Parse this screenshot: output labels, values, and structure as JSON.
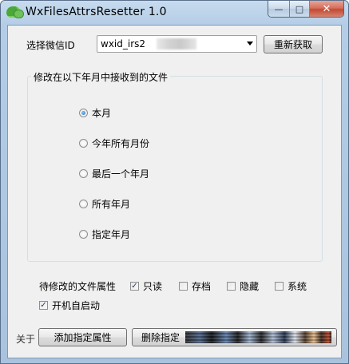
{
  "window": {
    "title": "WxFilesAttrsResetter 1.0",
    "controls": {
      "minimize": "—",
      "maximize": "□",
      "close": "✕"
    }
  },
  "wechat_id": {
    "label": "选择微信ID",
    "selected_value": "wxid_irs2",
    "refresh_button": "重新获取"
  },
  "month_group": {
    "title": "修改在以下年月中接收到的文件",
    "options": [
      {
        "label": "本月",
        "selected": true
      },
      {
        "label": "今年所有月份",
        "selected": false
      },
      {
        "label": "最后一个年月",
        "selected": false
      },
      {
        "label": "所有年月",
        "selected": false
      },
      {
        "label": "指定年月",
        "selected": false
      }
    ]
  },
  "attributes": {
    "label": "待修改的文件属性",
    "items": [
      {
        "label": "只读",
        "checked": true
      },
      {
        "label": "存档",
        "checked": false
      },
      {
        "label": "隐藏",
        "checked": false
      },
      {
        "label": "系统",
        "checked": false
      }
    ]
  },
  "autostart": {
    "label": "开机自启动",
    "checked": true
  },
  "footer": {
    "about_link": "关于",
    "add_button": "添加指定属性",
    "delete_button": "删除指定"
  },
  "icons": {
    "app": "wechat-icon",
    "dropdown": "chevron-down-icon",
    "checkmark": "✓"
  }
}
